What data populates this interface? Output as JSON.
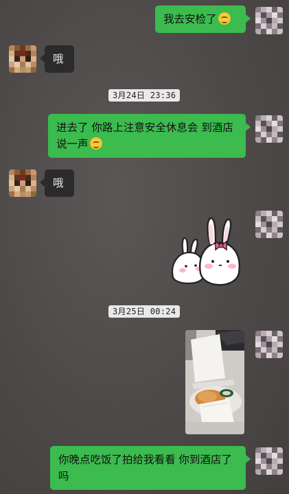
{
  "messages": [
    {
      "side": "me",
      "text": "我去安检了",
      "emoji": "face-icon"
    },
    {
      "side": "them",
      "text": "哦"
    },
    {
      "side": "me",
      "text": "进去了 你路上注意安全休息会 到酒店说一声",
      "emoji": "face-icon"
    },
    {
      "side": "them",
      "text": "哦"
    },
    {
      "side": "me",
      "type": "sticker",
      "sticker": "bunnies-sticker"
    },
    {
      "side": "me",
      "type": "image",
      "image": "food-photo"
    },
    {
      "side": "me",
      "text": "你晚点吃饭了拍给我看看 你到酒店了吗"
    }
  ],
  "timestamps": [
    "3月24日 23:36",
    "3月25日 00:24"
  ],
  "colors": {
    "sent_bubble": "#3cbb4f",
    "received_bubble": "#2b2b2b",
    "background": "#4d4948",
    "timestamp_bg": "#e9e9e9"
  }
}
